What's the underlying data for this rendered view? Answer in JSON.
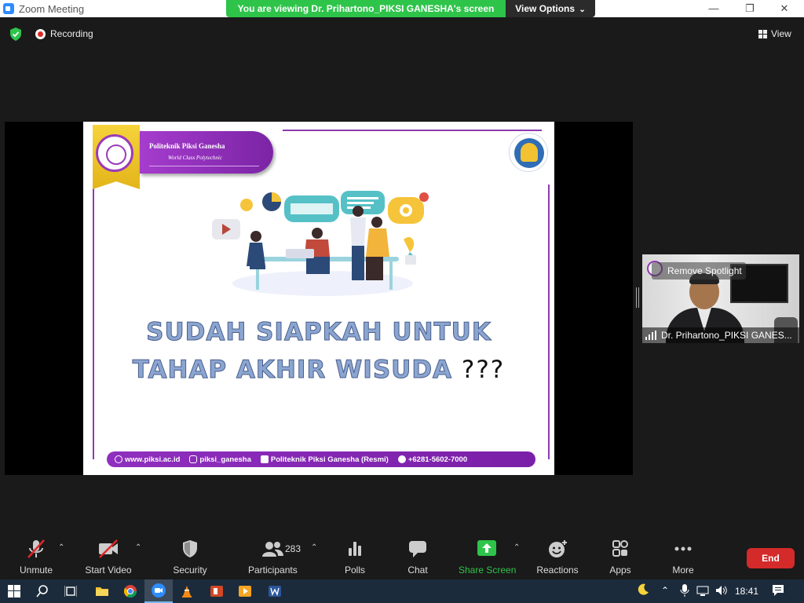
{
  "window": {
    "title": "Zoom Meeting",
    "minimize": "—",
    "maximize": "❐",
    "close": "✕"
  },
  "banner": {
    "message": "You are viewing Dr. Prihartono_PIKSI GANESHA's screen",
    "view_options": "View Options",
    "view_options_chevron": "⌄"
  },
  "status": {
    "recording": "Recording",
    "view": "View"
  },
  "slide": {
    "institution": "Politeknik Piksi Ganesha",
    "tagline": "World Class Polytechnic",
    "headline_line1": "SUDAH SIAPKAH UNTUK",
    "headline_line2": "TAHAP AKHIR WISUDA",
    "headline_suffix": "???",
    "footer": {
      "website": "www.piksi.ac.id",
      "instagram": "piksi_ganesha",
      "facebook": "Politeknik Piksi Ganesha (Resmi)",
      "phone": "+6281-5602-7000"
    }
  },
  "video_tile": {
    "name": "Dr. Prihartono_PIKSI GANES...",
    "remove_spotlight": "Remove Spotlight"
  },
  "controls": {
    "unmute": "Unmute",
    "start_video": "Start Video",
    "security": "Security",
    "participants": "Participants",
    "participants_count": "283",
    "polls": "Polls",
    "chat": "Chat",
    "share_screen": "Share Screen",
    "reactions": "Reactions",
    "apps": "Apps",
    "more": "More",
    "end": "End"
  },
  "taskbar": {
    "time": "18:41"
  },
  "colors": {
    "share_green": "#2ec44a",
    "end_red": "#d42a2a",
    "slide_purple": "#8e3bb0",
    "headline_blue": "#8ba5d1"
  }
}
